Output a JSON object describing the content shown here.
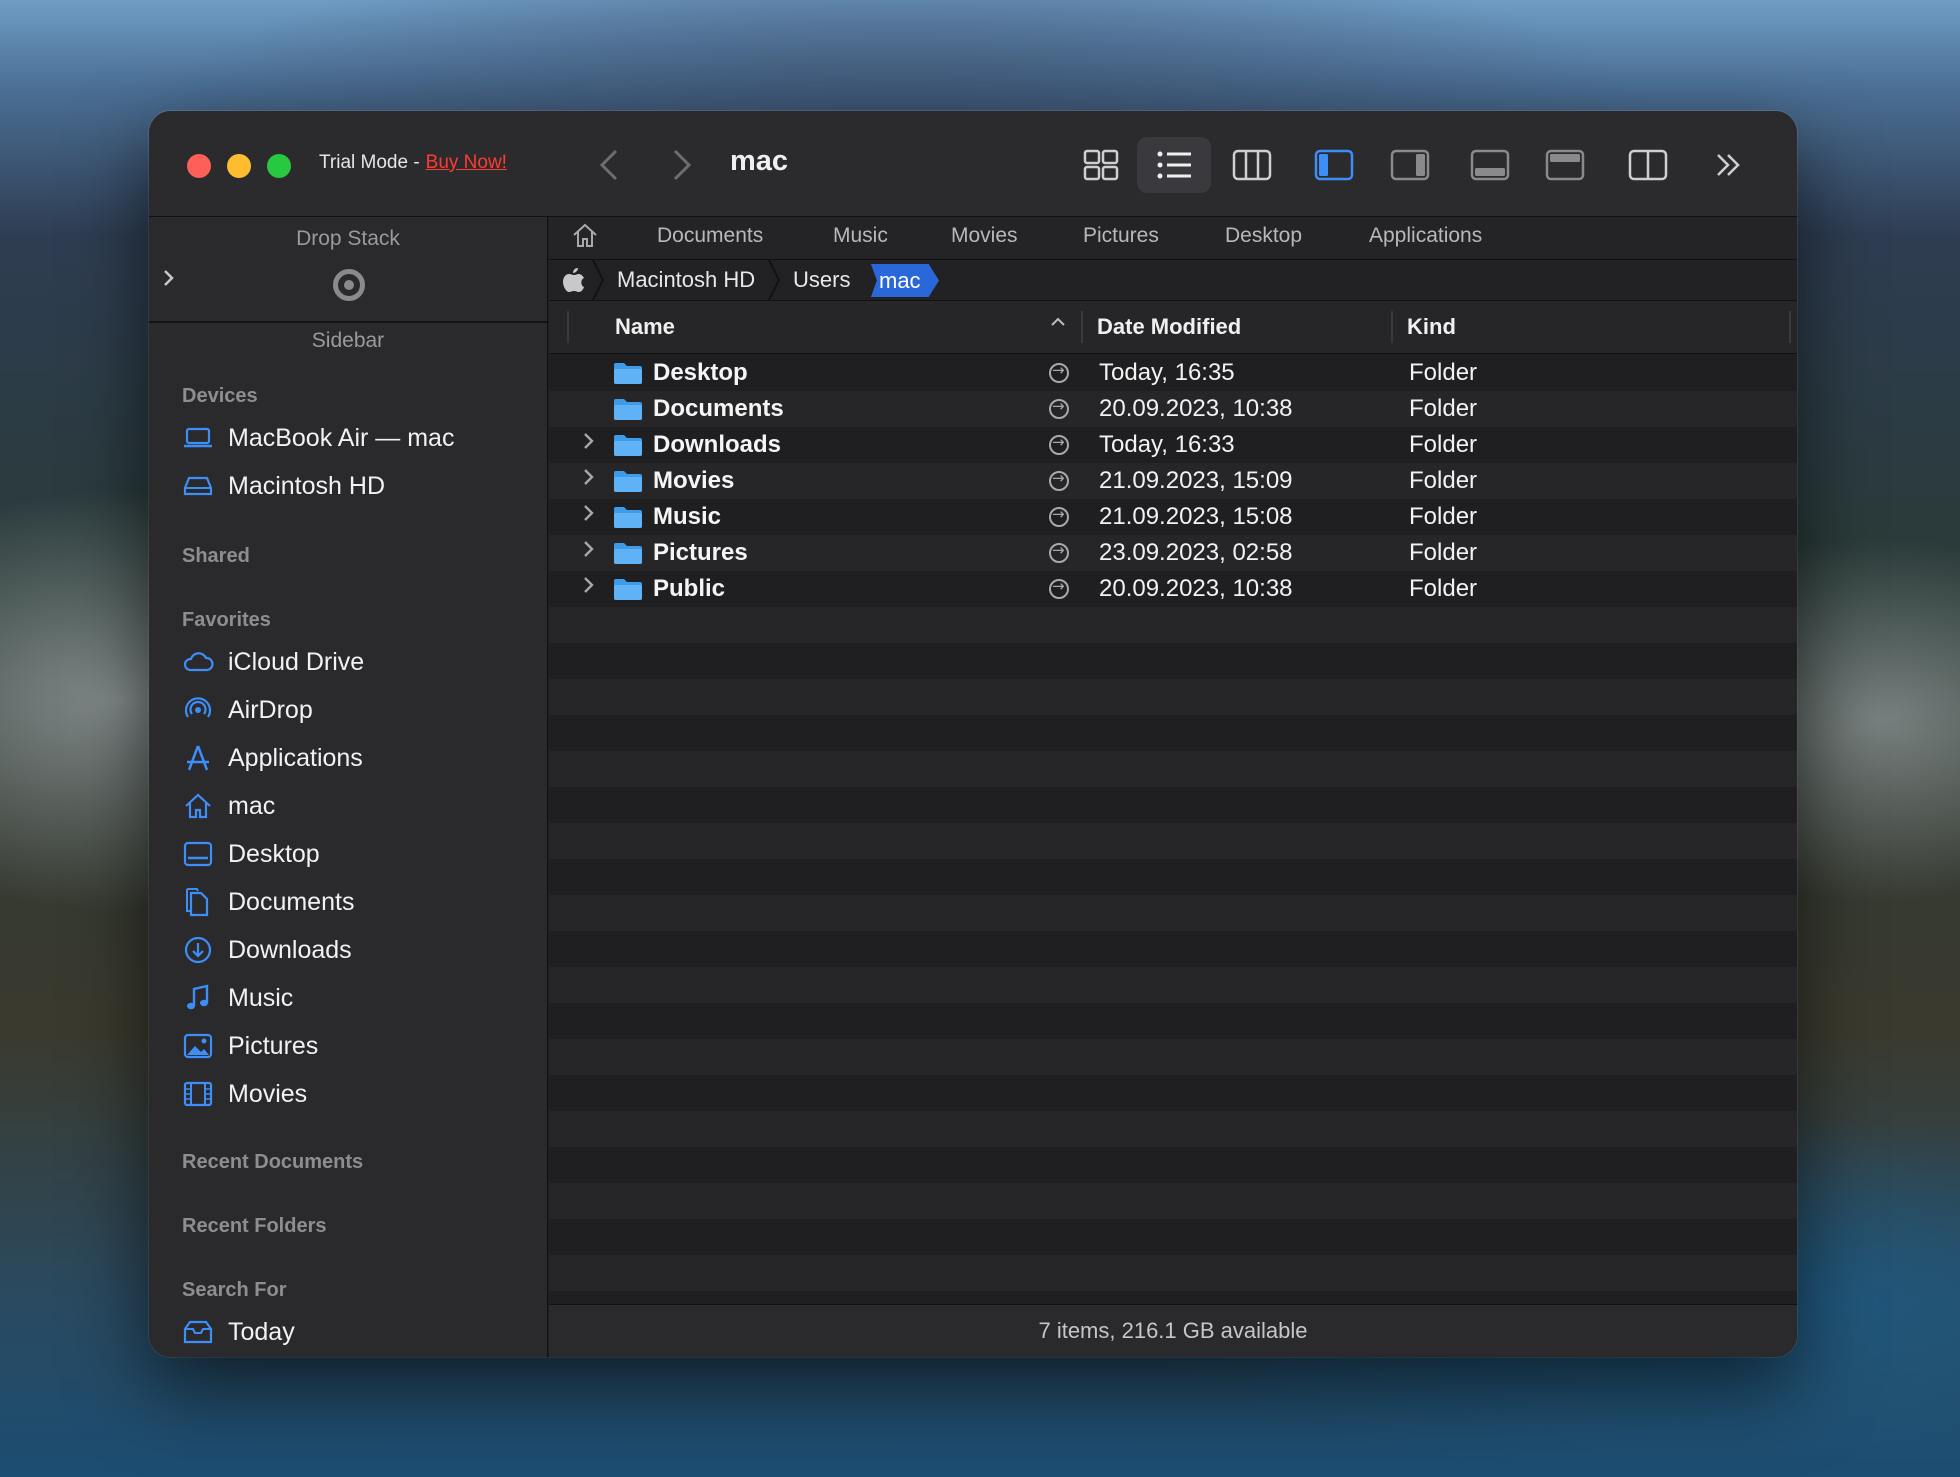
{
  "window": {
    "trial_text": "Trial Mode -",
    "buy_label": "Buy Now!",
    "title": "mac"
  },
  "toolbar": {
    "buttons": [
      {
        "name": "icon-view-button",
        "icon": "grid-icon"
      },
      {
        "name": "list-view-button",
        "icon": "list-icon",
        "active": true
      },
      {
        "name": "column-view-button",
        "icon": "columns-icon"
      },
      {
        "name": "sidebar-toggle-button",
        "icon": "left-panel-icon",
        "active_color": "#3d8ef7"
      },
      {
        "name": "preview-toggle-button",
        "icon": "right-panel-icon"
      },
      {
        "name": "bottom-panel-button",
        "icon": "bottom-panel-icon"
      },
      {
        "name": "top-panel-button",
        "icon": "top-panel-icon"
      },
      {
        "name": "dual-pane-button",
        "icon": "split-panel-icon"
      },
      {
        "name": "more-button",
        "icon": "double-chevron-right-icon"
      }
    ]
  },
  "sidebar": {
    "drop_stack_title": "Drop Stack",
    "sidebar_title": "Sidebar",
    "sections": {
      "devices": "Devices",
      "shared": "Shared",
      "favorites": "Favorites",
      "recent_documents": "Recent Documents",
      "recent_folders": "Recent Folders",
      "search_for": "Search For"
    },
    "devices": [
      {
        "label": "MacBook Air — mac",
        "icon": "laptop-icon"
      },
      {
        "label": "Macintosh HD",
        "icon": "disk-icon"
      }
    ],
    "favorites": [
      {
        "label": "iCloud Drive",
        "icon": "cloud-icon"
      },
      {
        "label": "AirDrop",
        "icon": "airdrop-icon"
      },
      {
        "label": "Applications",
        "icon": "applications-icon"
      },
      {
        "label": "mac",
        "icon": "home-icon"
      },
      {
        "label": "Desktop",
        "icon": "desktop-icon"
      },
      {
        "label": "Documents",
        "icon": "documents-icon"
      },
      {
        "label": "Downloads",
        "icon": "downloads-icon"
      },
      {
        "label": "Music",
        "icon": "music-icon"
      },
      {
        "label": "Pictures",
        "icon": "pictures-icon"
      },
      {
        "label": "Movies",
        "icon": "movies-icon"
      }
    ],
    "search_for": [
      {
        "label": "Today",
        "icon": "search-today-icon"
      }
    ]
  },
  "favorites_bar": [
    "Documents",
    "Music",
    "Movies",
    "Pictures",
    "Desktop",
    "Applications"
  ],
  "breadcrumb": [
    "Macintosh HD",
    "Users",
    "mac"
  ],
  "columns": {
    "name": "Name",
    "date": "Date Modified",
    "kind": "Kind"
  },
  "files": [
    {
      "name": "Desktop",
      "date": "Today, 16:35",
      "kind": "Folder",
      "expandable": false
    },
    {
      "name": "Documents",
      "date": "20.09.2023, 10:38",
      "kind": "Folder",
      "expandable": false
    },
    {
      "name": "Downloads",
      "date": "Today, 16:33",
      "kind": "Folder",
      "expandable": true
    },
    {
      "name": "Movies",
      "date": "21.09.2023, 15:09",
      "kind": "Folder",
      "expandable": true
    },
    {
      "name": "Music",
      "date": "21.09.2023, 15:08",
      "kind": "Folder",
      "expandable": true
    },
    {
      "name": "Pictures",
      "date": "23.09.2023, 02:58",
      "kind": "Folder",
      "expandable": true
    },
    {
      "name": "Public",
      "date": "20.09.2023, 10:38",
      "kind": "Folder",
      "expandable": true
    }
  ],
  "status": "7 items, 216.1 GB available",
  "colors": {
    "accent": "#3d8ef7",
    "crumb_active": "#2a67d8",
    "buy": "#ff3b30"
  }
}
